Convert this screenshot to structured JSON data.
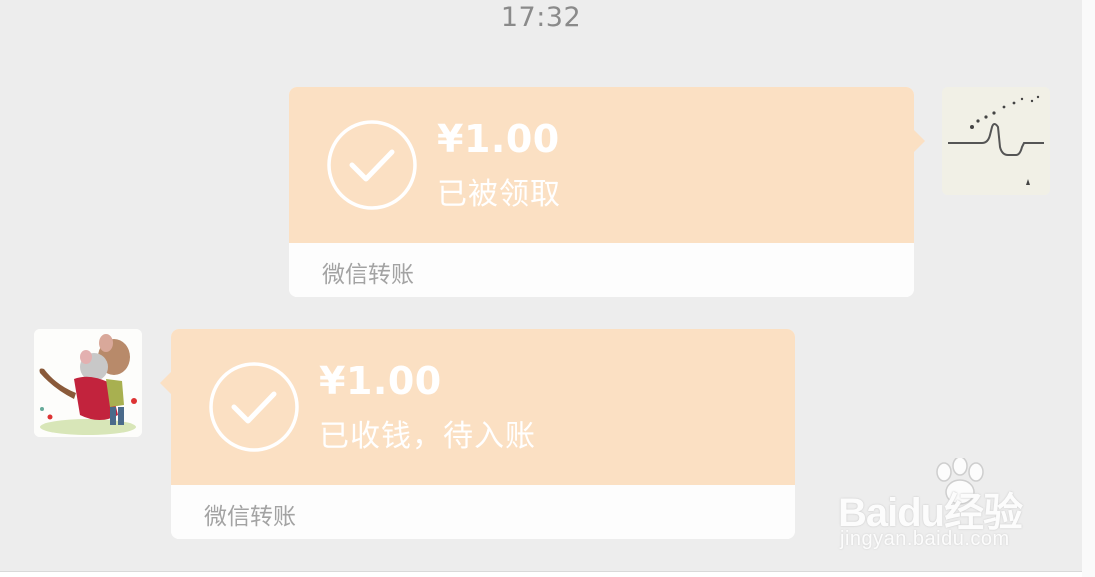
{
  "chat": {
    "timestamp": "17:32",
    "messages": [
      {
        "sender": "self",
        "amount": "¥1.00",
        "status": "已被领取",
        "footer": "微信转账"
      },
      {
        "sender": "other",
        "amount": "¥1.00",
        "status": "已收钱，待入账",
        "footer": "微信转账"
      }
    ]
  },
  "colors": {
    "bubble_top": "#fbe0c3",
    "bubble_bottom": "#fdfdfd",
    "chat_background": "#ededed",
    "footer_text": "#a3a3a3"
  },
  "watermark": {
    "brand": "Baidu经验",
    "url": "jingyan.baidu.com"
  }
}
